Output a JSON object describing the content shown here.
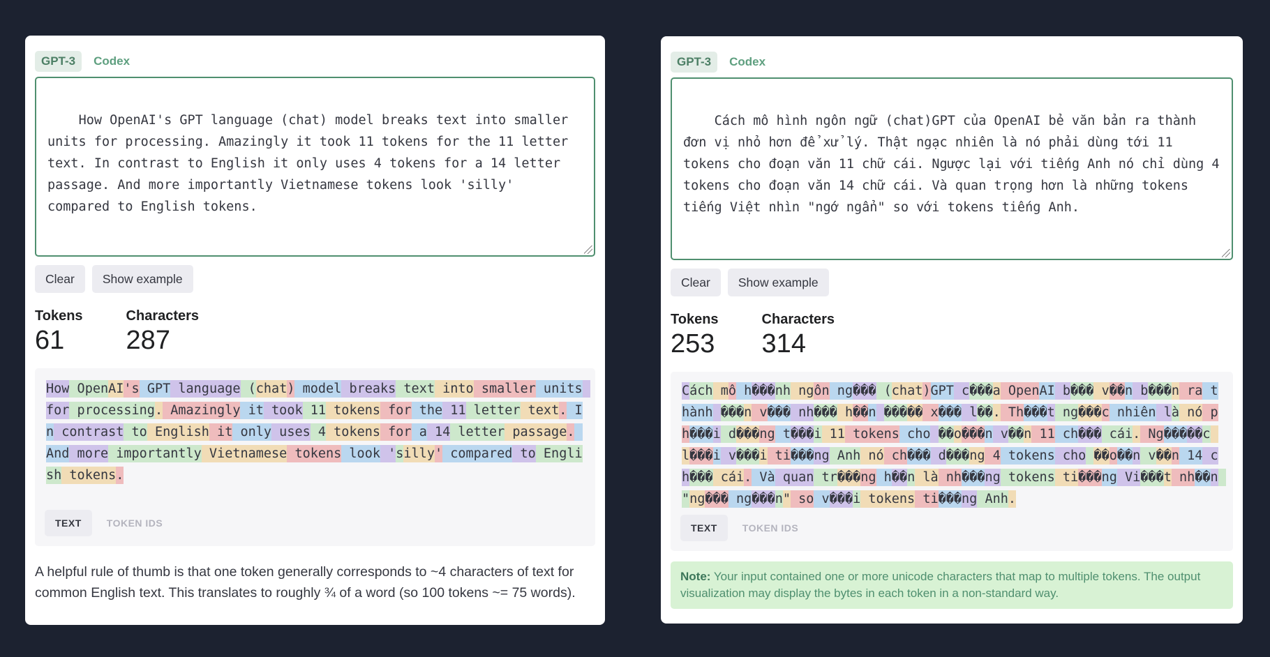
{
  "left": {
    "tabs": [
      "GPT-3",
      "Codex"
    ],
    "input_text": "How OpenAI's GPT language (chat) model breaks text into smaller units for processing. Amazingly it took 11 tokens for the 11 letter text. In contrast to English it only uses 4 tokens for a 14 letter passage. And more importantly Vietnamese tokens look 'silly' compared to English tokens.",
    "buttons": {
      "clear": "Clear",
      "show_example": "Show example"
    },
    "stats": {
      "tokens_label": "Tokens",
      "tokens_value": "61",
      "chars_label": "Characters",
      "chars_value": "287"
    },
    "tokens": [
      "How",
      " Open",
      "AI",
      "'s",
      " GPT",
      " language",
      " (",
      "chat",
      ")",
      " model",
      " breaks",
      " text",
      " into",
      " smaller",
      " units",
      " for",
      " processing",
      ".",
      " Amazingly",
      " it",
      " took",
      " 11",
      " tokens",
      " for",
      " the",
      " 11",
      " letter",
      " text",
      ".",
      " In",
      " contrast",
      " to",
      " English",
      " it",
      " only",
      " uses",
      " 4",
      " tokens",
      " for",
      " a",
      " 14",
      " letter",
      " passage",
      ".",
      " And",
      " more",
      " importantly",
      " Vietnamese",
      " tokens",
      " look",
      " '",
      "s",
      "illy",
      "'",
      " compared",
      " to",
      " English",
      " tokens",
      "."
    ],
    "view_tabs": [
      "TEXT",
      "TOKEN IDS"
    ],
    "help_text": "A helpful rule of thumb is that one token generally corresponds to ~4 characters of text for common English text. This translates to roughly ¾ of a word (so 100 tokens ~= 75 words)."
  },
  "right": {
    "tabs": [
      "GPT-3",
      "Codex"
    ],
    "input_text": "Cách mô hình ngôn ngữ (chat)GPT của OpenAI bẻ văn bản ra thành đơn vị nhỏ hơn để xử lý. Thật ngạc nhiên là nó phải dùng tới 11 tokens cho đoạn văn 11 chữ cái. Ngược lại với tiếng Anh nó chỉ dùng 4 tokens cho đoạn văn 14 chữ cái. Và quan trọng hơn là những tokens tiếng Việt nhìn \"ngớ ngẩn\" so với tokens tiếng Anh.",
    "buttons": {
      "clear": "Clear",
      "show_example": "Show example"
    },
    "stats": {
      "tokens_label": "Tokens",
      "tokens_value": "253",
      "chars_label": "Characters",
      "chars_value": "314"
    },
    "tokens": [
      "C",
      "ách",
      " m",
      "ô",
      " h",
      "���",
      "nh",
      " ng",
      "ôn",
      " ng",
      "���",
      " (",
      "chat",
      ")",
      "GPT",
      " c",
      "���",
      "a",
      " Open",
      "AI",
      " b",
      "���",
      " v",
      "��",
      "n",
      " b",
      "���",
      "n",
      " ra",
      " thành",
      " ",
      "���",
      "n",
      " v",
      "���",
      " nh",
      "���",
      " h",
      "��",
      "n",
      " ",
      "���",
      "��",
      " x",
      "���",
      " l",
      "��",
      ".",
      " Th",
      "���",
      "t",
      " ng",
      "���",
      "c",
      " nhiên",
      " l",
      "à",
      " nó",
      " ph",
      "���",
      "i",
      " d",
      "���",
      "ng",
      " t",
      "���",
      "i",
      " 11",
      " tokens",
      " cho",
      " ",
      "��",
      "o",
      "���",
      "n",
      " v",
      "��",
      "n",
      " 11",
      " ch",
      "���",
      " cái",
      ".",
      " Ng",
      "���",
      "��",
      "c",
      " l",
      "���",
      "i",
      " v",
      "���",
      "i",
      " ti",
      "���",
      "ng",
      " Anh",
      " nó",
      " ch",
      "���",
      " d",
      "���",
      "ng",
      " 4",
      " tokens",
      " cho",
      " ",
      "��",
      "o",
      "��",
      "n",
      " v",
      "��",
      "n",
      " 14",
      " ch",
      "���",
      " cái",
      ".",
      " Và",
      " quan",
      " tr",
      "���",
      "ng",
      " h",
      "��",
      "n",
      " là",
      " nh",
      "���",
      "ng",
      " tokens",
      " ti",
      "���",
      "ng",
      " Vi",
      "���",
      "t",
      " nh",
      "��",
      "n",
      " \"",
      "ng",
      "���",
      " ng",
      "���",
      "n",
      "\"",
      " so",
      " v",
      "���",
      "i",
      " tokens",
      " ti",
      "���",
      "ng",
      " Anh",
      "."
    ],
    "view_tabs": [
      "TEXT",
      "TOKEN IDS"
    ],
    "note_label": "Note:",
    "note_text": " Your input contained one or more unicode characters that map to multiple tokens. The output visualization may display the bytes in each token in a non-standard way."
  }
}
